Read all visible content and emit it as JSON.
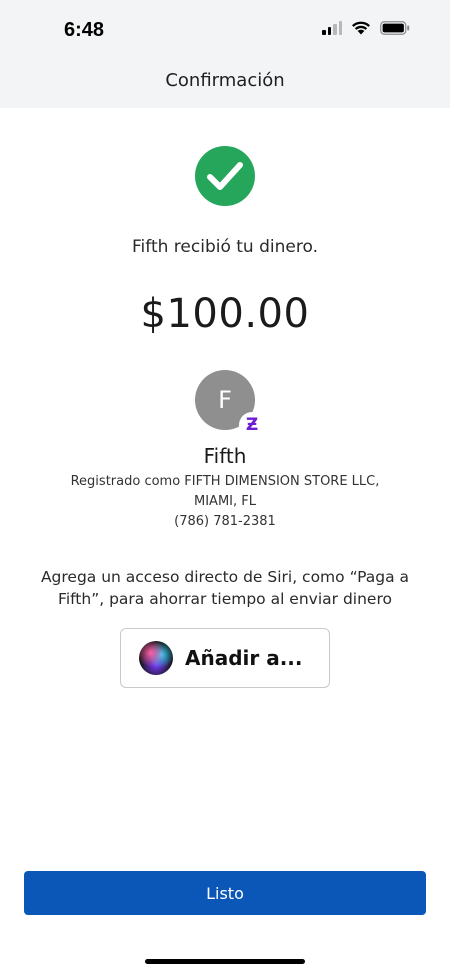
{
  "status_bar": {
    "time": "6:48",
    "signal_icon": "cellular-signal-icon",
    "wifi_icon": "wifi-icon",
    "battery_icon": "battery-icon"
  },
  "nav": {
    "title": "Confirmación"
  },
  "confirmation": {
    "check_icon": "checkmark-circle-icon",
    "message": "Fifth recibió tu dinero.",
    "amount": "$100.00"
  },
  "recipient": {
    "initial": "F",
    "badge_icon": "zelle-icon",
    "badge_glyph": "Ƶ",
    "name": "Fifth",
    "registered_line1": "Registrado como FIFTH DIMENSION STORE LLC,",
    "registered_line2": "MIAMI, FL",
    "phone": "(786) 781-2381"
  },
  "siri": {
    "prompt": "Agrega un acceso directo de Siri, como “Paga a Fifth”, para ahorrar tiempo al enviar dinero",
    "orb_icon": "siri-icon",
    "button_label": "Añadir a..."
  },
  "footer": {
    "done_label": "Listo"
  },
  "colors": {
    "success": "#26a65b",
    "primary": "#0a57b8",
    "zelle": "#6d1ed4",
    "avatar": "#8f8f8f"
  }
}
